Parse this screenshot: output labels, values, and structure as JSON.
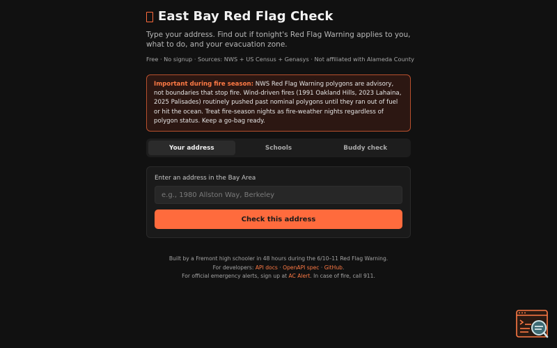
{
  "header": {
    "icon": "flame-icon",
    "title": "East Bay Red Flag Check",
    "subtitle": "Type your address. Find out if tonight's Red Flag Warning applies to you, what to do, and your evacuation zone.",
    "meta": "Free · No signup · Sources: NWS + US Census + Genasys · Not affiliated with Alameda County"
  },
  "warning": {
    "lead": "Important during fire season:",
    "body": " NWS Red Flag Warning polygons are advisory, not boundaries that stop fire. Wind-driven fires (1991 Oakland Hills, 2023 Lahaina, 2025 Palisades) routinely pushed past nominal polygons until they ran out of fuel or hit the ocean. Treat fire-season nights as fire-weather nights regardless of polygon status. Keep a go-bag ready."
  },
  "tabs": [
    {
      "label": "Your address",
      "active": true
    },
    {
      "label": "Schools",
      "active": false
    },
    {
      "label": "Buddy check",
      "active": false
    }
  ],
  "form": {
    "label": "Enter an address in the Bay Area",
    "placeholder": "e.g., 1980 Allston Way, Berkeley",
    "value": "",
    "button": "Check this address"
  },
  "footer": {
    "line1": "Built by a Fremont high schooler in 48 hours during the 6/10–11 Red Flag Warning.",
    "line2_prefix": "For developers: ",
    "api_docs": "API docs",
    "sep1": " · ",
    "openapi": "OpenAPI spec",
    "sep2": " · ",
    "github": "GitHub",
    "line2_suffix": ".",
    "line3_prefix": "For official emergency alerts, sign up at ",
    "ac_alert": "AC Alert",
    "line3_suffix": ". In case of fire, call 911."
  },
  "widget": {
    "icon": "terminal-search-icon"
  },
  "colors": {
    "accent": "#ff6b3d",
    "background": "#111111",
    "warning_border": "#b8502e"
  }
}
